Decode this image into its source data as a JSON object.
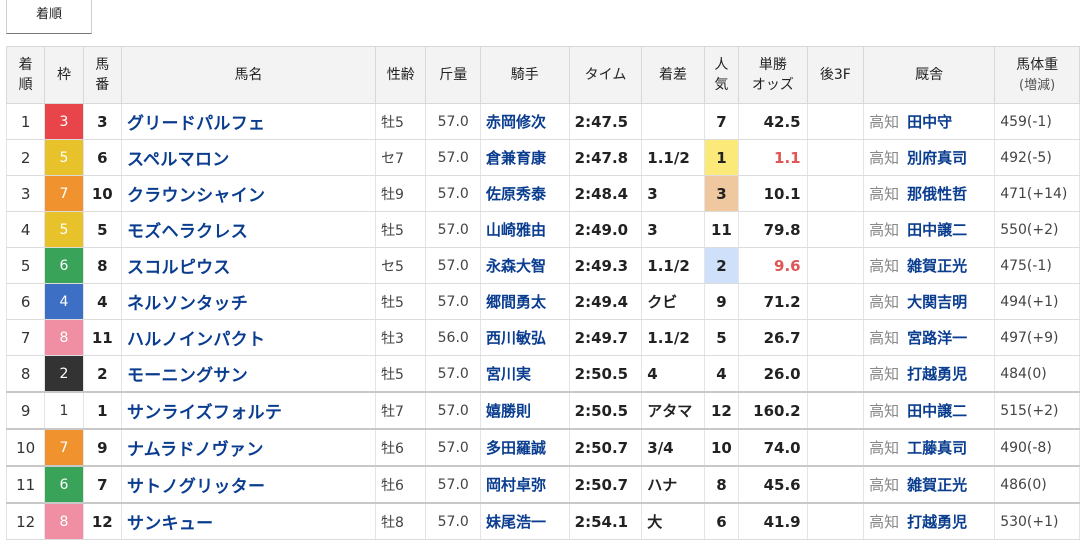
{
  "tab": {
    "label": "着順"
  },
  "headers": {
    "rank": [
      "着",
      "順"
    ],
    "waku": "枠",
    "umaban": [
      "馬",
      "番"
    ],
    "horse": "馬名",
    "sexage": "性齢",
    "weight": "斤量",
    "jockey": "騎手",
    "time": "タイム",
    "margin": "着差",
    "popularity": [
      "人",
      "気"
    ],
    "odds": [
      "単勝",
      "オッズ"
    ],
    "last3f": "後3F",
    "stable": "厩舎",
    "bodyweight": [
      "馬体重",
      "(増減)"
    ]
  },
  "waku_colors": {
    "1": "#ffffff",
    "2": "#333333",
    "3": "#e8454a",
    "4": "#3d6fc4",
    "5": "#e8c22a",
    "6": "#3aa35a",
    "7": "#f0922e",
    "8": "#f08fa4"
  },
  "rows": [
    {
      "rank": "1",
      "waku": "3",
      "umaban": "3",
      "horse": "グリードパルフェ",
      "sexage": "牡5",
      "weight": "57.0",
      "jockey": "赤岡修次",
      "time": "2:47.5",
      "margin": "",
      "pop": "7",
      "odds": "42.5",
      "last3f": "",
      "region": "高知",
      "trainer": "田中守",
      "bodyweight": "459(-1)"
    },
    {
      "rank": "2",
      "waku": "5",
      "umaban": "6",
      "horse": "スペルマロン",
      "sexage": "セ7",
      "weight": "57.0",
      "jockey": "倉兼育康",
      "time": "2:47.8",
      "margin": "1.1/2",
      "pop": "1",
      "odds": "1.1",
      "last3f": "",
      "region": "高知",
      "trainer": "別府真司",
      "bodyweight": "492(-5)"
    },
    {
      "rank": "3",
      "waku": "7",
      "umaban": "10",
      "horse": "クラウンシャイン",
      "sexage": "牡9",
      "weight": "57.0",
      "jockey": "佐原秀泰",
      "time": "2:48.4",
      "margin": "3",
      "pop": "3",
      "odds": "10.1",
      "last3f": "",
      "region": "高知",
      "trainer": "那俄性哲",
      "bodyweight": "471(+14)"
    },
    {
      "rank": "4",
      "waku": "5",
      "umaban": "5",
      "horse": "モズヘラクレス",
      "sexage": "牡5",
      "weight": "57.0",
      "jockey": "山崎雅由",
      "time": "2:49.0",
      "margin": "3",
      "pop": "11",
      "odds": "79.8",
      "last3f": "",
      "region": "高知",
      "trainer": "田中譲二",
      "bodyweight": "550(+2)"
    },
    {
      "rank": "5",
      "waku": "6",
      "umaban": "8",
      "horse": "スコルピウス",
      "sexage": "セ5",
      "weight": "57.0",
      "jockey": "永森大智",
      "time": "2:49.3",
      "margin": "1.1/2",
      "pop": "2",
      "odds": "9.6",
      "last3f": "",
      "region": "高知",
      "trainer": "雑賀正光",
      "bodyweight": "475(-1)"
    },
    {
      "rank": "6",
      "waku": "4",
      "umaban": "4",
      "horse": "ネルソンタッチ",
      "sexage": "牡5",
      "weight": "57.0",
      "jockey": "郷間勇太",
      "time": "2:49.4",
      "margin": "クビ",
      "pop": "9",
      "odds": "71.2",
      "last3f": "",
      "region": "高知",
      "trainer": "大関吉明",
      "bodyweight": "494(+1)"
    },
    {
      "rank": "7",
      "waku": "8",
      "umaban": "11",
      "horse": "ハルノインパクト",
      "sexage": "牡3",
      "weight": "56.0",
      "jockey": "西川敏弘",
      "time": "2:49.7",
      "margin": "1.1/2",
      "pop": "5",
      "odds": "26.7",
      "last3f": "",
      "region": "高知",
      "trainer": "宮路洋一",
      "bodyweight": "497(+9)"
    },
    {
      "rank": "8",
      "waku": "2",
      "umaban": "2",
      "horse": "モーニングサン",
      "sexage": "牡5",
      "weight": "57.0",
      "jockey": "宮川実",
      "time": "2:50.5",
      "margin": "4",
      "pop": "4",
      "odds": "26.0",
      "last3f": "",
      "region": "高知",
      "trainer": "打越勇児",
      "bodyweight": "484(0)"
    },
    {
      "rank": "9",
      "waku": "1",
      "umaban": "1",
      "horse": "サンライズフォルテ",
      "sexage": "牡7",
      "weight": "57.0",
      "jockey": "嬉勝則",
      "time": "2:50.5",
      "margin": "アタマ",
      "pop": "12",
      "odds": "160.2",
      "last3f": "",
      "region": "高知",
      "trainer": "田中譲二",
      "bodyweight": "515(+2)"
    },
    {
      "rank": "10",
      "waku": "7",
      "umaban": "9",
      "horse": "ナムラドノヴァン",
      "sexage": "牡6",
      "weight": "57.0",
      "jockey": "多田羅誠",
      "time": "2:50.7",
      "margin": "3/4",
      "pop": "10",
      "odds": "74.0",
      "last3f": "",
      "region": "高知",
      "trainer": "工藤真司",
      "bodyweight": "490(-8)"
    },
    {
      "rank": "11",
      "waku": "6",
      "umaban": "7",
      "horse": "サトノグリッター",
      "sexage": "牡6",
      "weight": "57.0",
      "jockey": "岡村卓弥",
      "time": "2:50.7",
      "margin": "ハナ",
      "pop": "8",
      "odds": "45.6",
      "last3f": "",
      "region": "高知",
      "trainer": "雑賀正光",
      "bodyweight": "486(0)"
    },
    {
      "rank": "12",
      "waku": "8",
      "umaban": "12",
      "horse": "サンキュー",
      "sexage": "牡8",
      "weight": "57.0",
      "jockey": "妹尾浩一",
      "time": "2:54.1",
      "margin": "大",
      "pop": "6",
      "odds": "41.9",
      "last3f": "",
      "region": "高知",
      "trainer": "打越勇児",
      "bodyweight": "530(+1)"
    }
  ]
}
